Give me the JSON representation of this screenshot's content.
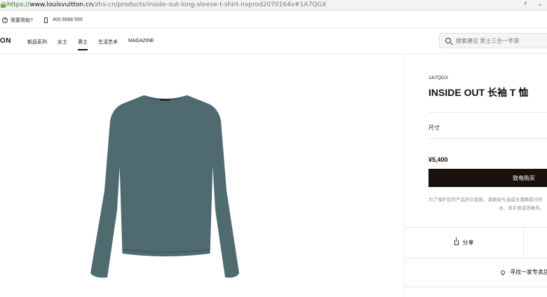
{
  "browser": {
    "url_scheme": "https://",
    "url_host": "www.louisvuitton.cn",
    "url_path": "/zhs-cn/products/inside-out-long-sleeve-t-shirt-nvprod2070164v#1A7QGX"
  },
  "utility": {
    "help_label": "需要帮助?",
    "phone": "400 6588 555"
  },
  "header": {
    "logo": "ON",
    "nav": [
      "新品系列",
      "女士",
      "男士",
      "生活艺术",
      "MAGAZINE"
    ],
    "active_nav": "男士",
    "search_placeholder": "搜索建议 男士三合一手袋"
  },
  "product": {
    "sku": "1A7QGX",
    "title": "INSIDE OUT 长袖 T 恤",
    "size_label": "尺寸",
    "price": "¥5,400",
    "buy_label": "致电购买",
    "care_note_line1": "为了保护您的产品历久如新，请避免与油或含酒精成分的",
    "care_note_line2": "水、洗手液或消毒剂。",
    "share_label": "分享",
    "store_label": "寻找一家专卖店"
  },
  "colors": {
    "sweater": "#4f6b70",
    "button_bg": "#19110b"
  }
}
